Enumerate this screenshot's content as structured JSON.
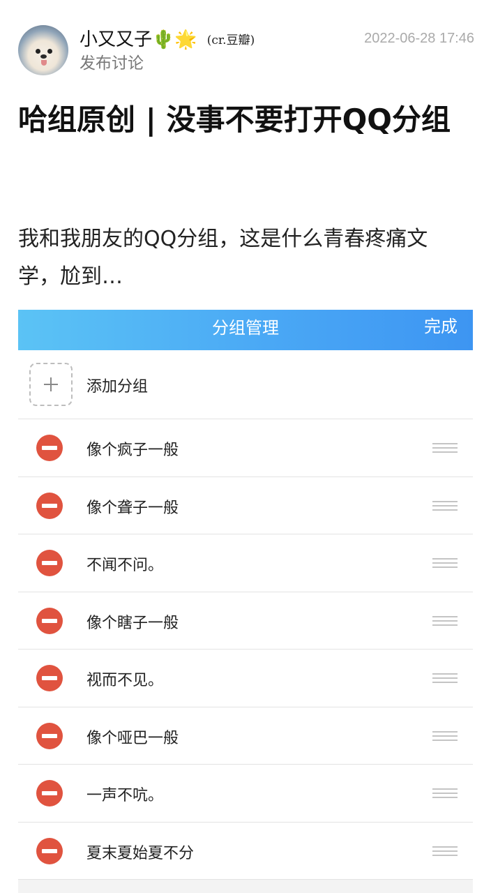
{
  "post": {
    "author": "小又又子",
    "author_emoji": "🌵🌟",
    "credit": "(cr.豆瓣)",
    "subline": "发布讨论",
    "timestamp": "2022-06-28 17:46",
    "title": "哈组原创 | 没事不要打开QQ分组",
    "body": "我和我朋友的QQ分组，这是什么青春疼痛文学，尬到…"
  },
  "panel": {
    "title": "分组管理",
    "done_label": "完成",
    "add_label": "添加分组",
    "groups": [
      {
        "label": "像个疯子一般"
      },
      {
        "label": "像个聋子一般"
      },
      {
        "label": "不闻不问。"
      },
      {
        "label": "像个瞎子一般"
      },
      {
        "label": "视而不见。"
      },
      {
        "label": "像个哑巴一般"
      },
      {
        "label": "一声不吭。"
      },
      {
        "label": "夏末夏始夏不分"
      }
    ]
  },
  "colors": {
    "header_gradient_start": "#5bc3f5",
    "header_gradient_end": "#3d95f2",
    "delete_icon": "#e0533f"
  },
  "icons": [
    "avatar-dog-photo",
    "plus-icon",
    "delete-minus-icon",
    "drag-handle-icon"
  ]
}
